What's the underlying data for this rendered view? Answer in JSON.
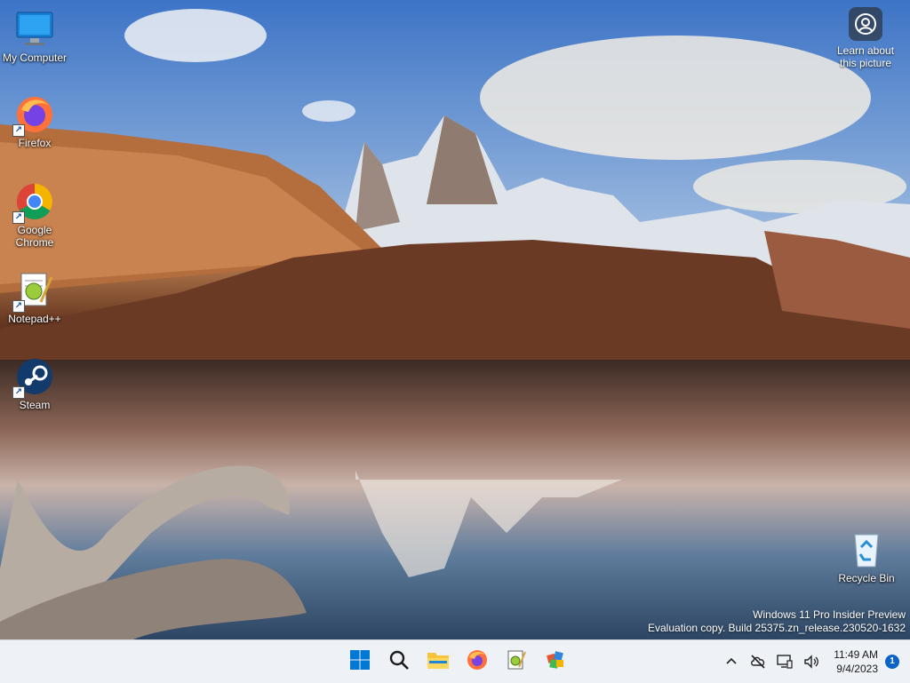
{
  "desktop": {
    "icons": [
      {
        "name": "my-computer",
        "label": "My Computer"
      },
      {
        "name": "firefox",
        "label": "Firefox"
      },
      {
        "name": "google-chrome",
        "label": "Google\nChrome"
      },
      {
        "name": "notepad-plus-plus",
        "label": "Notepad++"
      },
      {
        "name": "steam",
        "label": "Steam"
      },
      {
        "name": "recycle-bin",
        "label": "Recycle Bin"
      }
    ],
    "learn_about": {
      "label": "Learn about\nthis picture",
      "icon": "camera-icon"
    }
  },
  "watermark": {
    "line1": "Windows 11 Pro Insider Preview",
    "line2": "Evaluation copy. Build 25375.zn_release.230520-1632"
  },
  "taskbar": {
    "apps": [
      {
        "name": "start",
        "icon": "windows-logo-icon"
      },
      {
        "name": "search",
        "icon": "search-icon"
      },
      {
        "name": "file-explorer",
        "icon": "folder-icon"
      },
      {
        "name": "firefox",
        "icon": "firefox-icon"
      },
      {
        "name": "notepad-plus-plus",
        "icon": "notepad-plus-plus-icon"
      },
      {
        "name": "extra-app",
        "icon": "app-icon"
      }
    ],
    "tray": {
      "icons": [
        "chevron-up-icon",
        "network-off-icon",
        "display-icon",
        "volume-icon"
      ],
      "time": "11:49 AM",
      "date": "9/4/2023",
      "notification_count": "1"
    }
  },
  "colors": {
    "taskbar_bg": "#eef1f6",
    "accent": "#0b63c9"
  }
}
